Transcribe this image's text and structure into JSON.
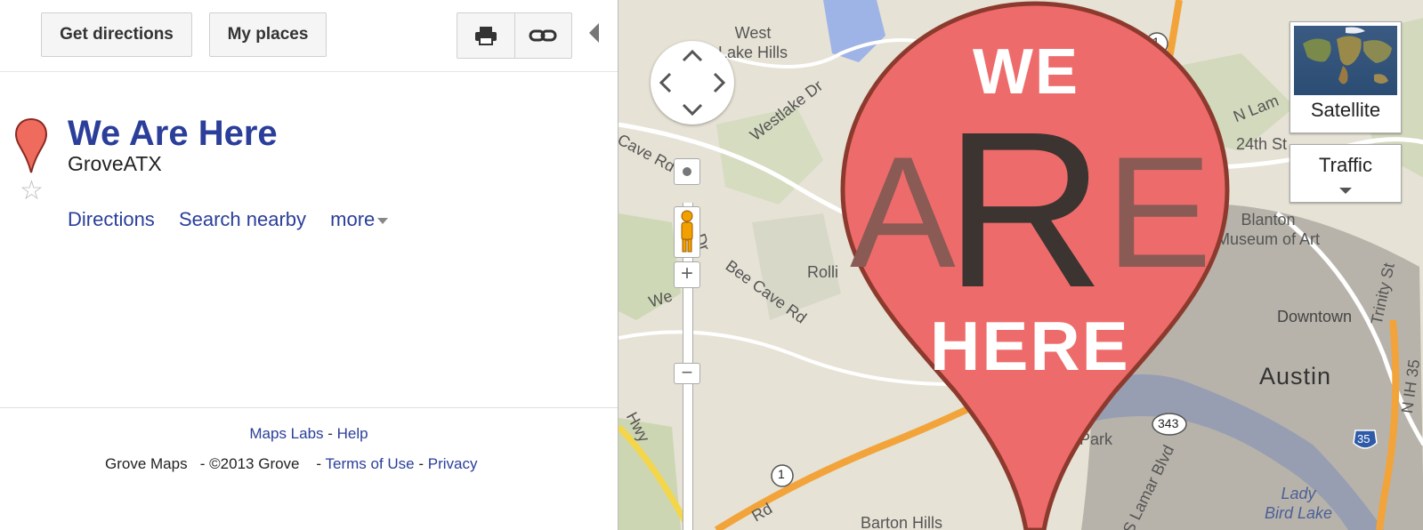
{
  "toolbar": {
    "get_directions_label": "Get directions",
    "my_places_label": "My places",
    "print_icon": "print-icon",
    "link_icon": "link-icon"
  },
  "place": {
    "title": "We Are Here",
    "subtitle": "GroveATX",
    "actions": [
      "Directions",
      "Search nearby",
      "more"
    ]
  },
  "footer": {
    "maps_labs": "Maps Labs",
    "sep1": " - ",
    "help": "Help",
    "brand": "Grove Maps",
    "copyright": "- ©2013 Grove",
    "sep2": "- ",
    "terms": "Terms of Use",
    "sep3": " - ",
    "privacy": "Privacy"
  },
  "map": {
    "labels": {
      "west_lake_hills": "West\nLake Hills",
      "westlake_dr": "Westlake Dr",
      "cave_rd": "Cave Rd",
      "bee_cave_rd": "Bee Cave Rd",
      "rollingwood": "Rolli",
      "we_dr": "We",
      "dr": "Dr",
      "n_lamar": "N Lam",
      "st_24th": "24th St",
      "blanton": "Blanton\nMuseum of Art",
      "downtown": "Downtown",
      "austin": "Austin",
      "trinity": "Trinity St",
      "n_ih_35": "N IH 35",
      "lady_bird_lake": "Lady\nBird Lake",
      "barton_hills": "Barton Hills",
      "hwy": "Hwy",
      "rd": "Rd",
      "park": "Park",
      "s_lamar": "S Lamar Blvd",
      "highway_1": "1",
      "highway_343": "343",
      "highway_35": "35"
    },
    "map_type_satellite": "Satellite",
    "traffic": "Traffic",
    "pin_overlay": {
      "we": "WE",
      "a": "A",
      "r": "R",
      "e": "E",
      "here": "HERE",
      "color": "#ee6b6b"
    }
  }
}
